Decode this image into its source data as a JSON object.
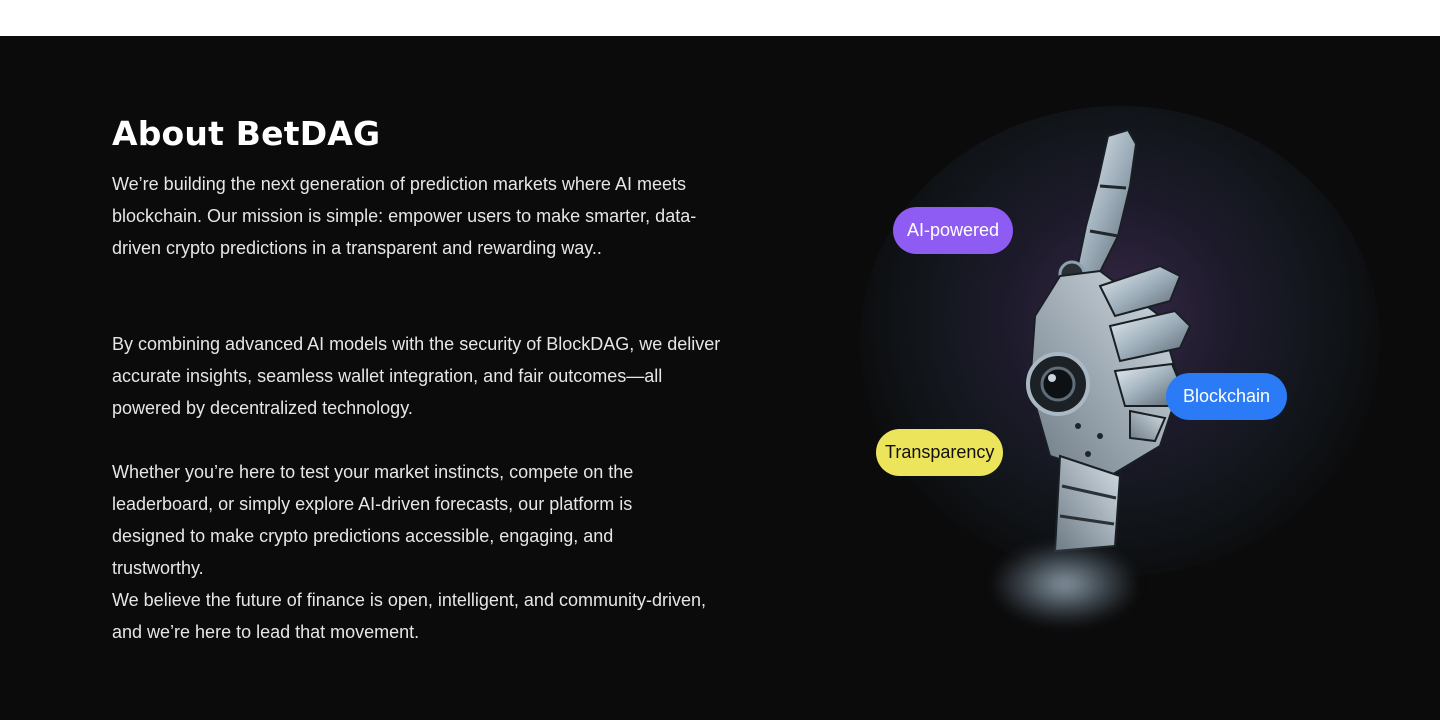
{
  "about": {
    "title": "About BetDAG",
    "paragraphs": [
      "We’re building the next generation of prediction markets where AI meets blockchain. Our mission is simple: empower users to make smarter, data-driven crypto predictions in a transparent and rewarding way..",
      "By combining advanced AI models with the security of BlockDAG, we deliver accurate insights, seamless wallet integration, and fair outcomes—all powered by decentralized technology.",
      "Whether you’re here to test your market instincts, compete on the leaderboard, or simply explore AI-driven forecasts, our platform is designed to make crypto predictions accessible, engaging, and trustworthy.",
      "We believe the future of finance is open, intelligent, and community-driven, and we’re here to lead that movement."
    ]
  },
  "tags": {
    "ai": "AI-powered",
    "blockchain": "Blockchain",
    "transparency": "Transparency"
  },
  "colors": {
    "background": "#0b0b0c",
    "ai_pill": "#8e5cf2",
    "blockchain_pill": "#2a7bf5",
    "transparency_pill": "#ece45a"
  },
  "image": {
    "subject": "robotic-hand-pointing-up"
  }
}
